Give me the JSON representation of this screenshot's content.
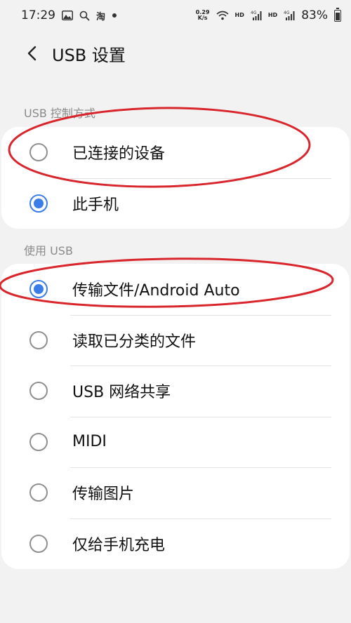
{
  "status_bar": {
    "time": "17:29",
    "taobao": "淘",
    "net_speed_top": "0.29",
    "net_speed_bottom": "K/s",
    "hd1": "HD",
    "sig1": "4G",
    "hd2": "HD",
    "sig2": "4G",
    "battery": "83%"
  },
  "header": {
    "title": "USB 设置"
  },
  "usb_control": {
    "label": "USB 控制方式",
    "options": [
      {
        "label": "已连接的设备",
        "checked": false
      },
      {
        "label": "此手机",
        "checked": true
      }
    ]
  },
  "use_usb": {
    "label": "使用 USB",
    "options": [
      {
        "label": "传输文件/Android Auto",
        "checked": true
      },
      {
        "label": "读取已分类的文件",
        "checked": false
      },
      {
        "label": "USB 网络共享",
        "checked": false
      },
      {
        "label": "MIDI",
        "checked": false
      },
      {
        "label": "传输图片",
        "checked": false
      },
      {
        "label": "仅给手机充电",
        "checked": false
      }
    ]
  },
  "colors": {
    "accent": "#3b7de8",
    "annotation": "#d8262c"
  },
  "battery_level": 0.83
}
